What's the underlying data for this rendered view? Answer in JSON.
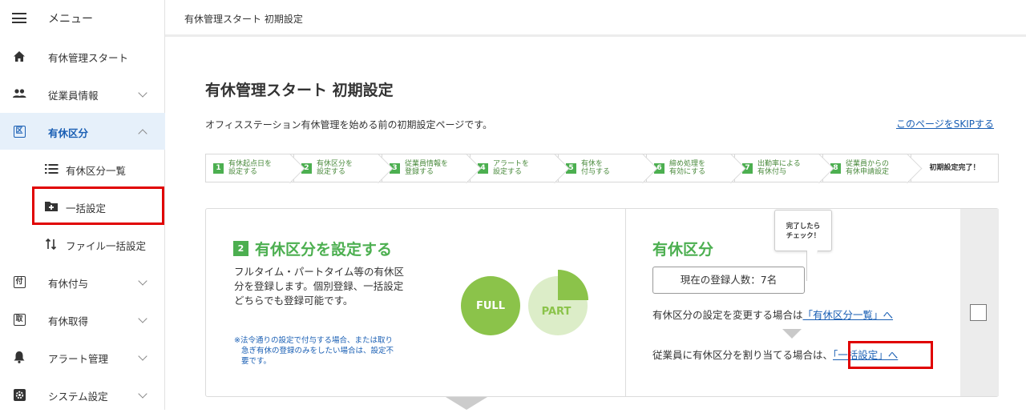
{
  "sidebar": {
    "menu_label": "メニュー",
    "items": [
      {
        "label": "有休管理スタート",
        "icon": "home-icon"
      },
      {
        "label": "従業員情報",
        "icon": "people-icon"
      },
      {
        "label": "有休区分",
        "icon": "ku-icon",
        "glyph": "区"
      },
      {
        "label": "有休付与",
        "icon": "fu-icon",
        "glyph": "付"
      },
      {
        "label": "有休取得",
        "icon": "shu-icon",
        "glyph": "取"
      },
      {
        "label": "アラート管理",
        "icon": "bell-icon"
      },
      {
        "label": "システム設定",
        "icon": "settings-icon"
      }
    ],
    "subitems": [
      {
        "label": "有休区分一覧",
        "icon": "list-icon"
      },
      {
        "label": "一括設定",
        "icon": "folder-add-icon"
      },
      {
        "label": "ファイル一括設定",
        "icon": "sort-arrows-icon"
      }
    ]
  },
  "topbar": {
    "breadcrumb": "有休管理スタート 初期設定"
  },
  "page": {
    "title": "有休管理スタート 初期設定",
    "description": "オフィスステーション有休管理を始める前の初期設定ページです。",
    "skip_link": "このページをSKIPする"
  },
  "steps": [
    {
      "num": "1",
      "line1": "有休起点日を",
      "line2": "設定する"
    },
    {
      "num": "2",
      "line1": "有休区分を",
      "line2": "設定する"
    },
    {
      "num": "3",
      "line1": "従業員情報を",
      "line2": "登録する"
    },
    {
      "num": "4",
      "line1": "アラートを",
      "line2": "設定する"
    },
    {
      "num": "5",
      "line1": "有休を",
      "line2": "付与する"
    },
    {
      "num": "6",
      "line1": "締め処理を",
      "line2": "有効にする"
    },
    {
      "num": "7",
      "line1": "出勤率による",
      "line2": "有休付与"
    },
    {
      "num": "8",
      "line1": "従業員からの",
      "line2": "有休申請設定"
    }
  ],
  "steps_final": "初期設定完了！",
  "card": {
    "step_num": "2",
    "heading": "有休区分を設定する",
    "body_lines": [
      "フルタイム・パートタイム等の有休区",
      "分を登録します。個別登録、一括設定",
      "どちらでも登録可能です。"
    ],
    "note_lines": [
      "※法令通りの設定で付与する場合、または取り",
      "急ぎ有休の登録のみをしたい場合は、設定不",
      "要です。"
    ],
    "full_label": "FULL",
    "part_label": "PART",
    "right_heading": "有休区分",
    "registered": "現在の登録人数：7名",
    "line1_prefix": "有休区分の設定を変更する場合は",
    "line1_link": "「有休区分一覧」へ",
    "line2_prefix": "従業員に有休区分を割り当てる場合は、",
    "line2_link": "「一括設定」へ"
  },
  "tooltip": {
    "line1": "完了したら",
    "line2": "チェック！"
  },
  "colors": {
    "accent_green": "#4caf50",
    "link_blue": "#1a5fb4",
    "highlight_red": "#e00000"
  }
}
